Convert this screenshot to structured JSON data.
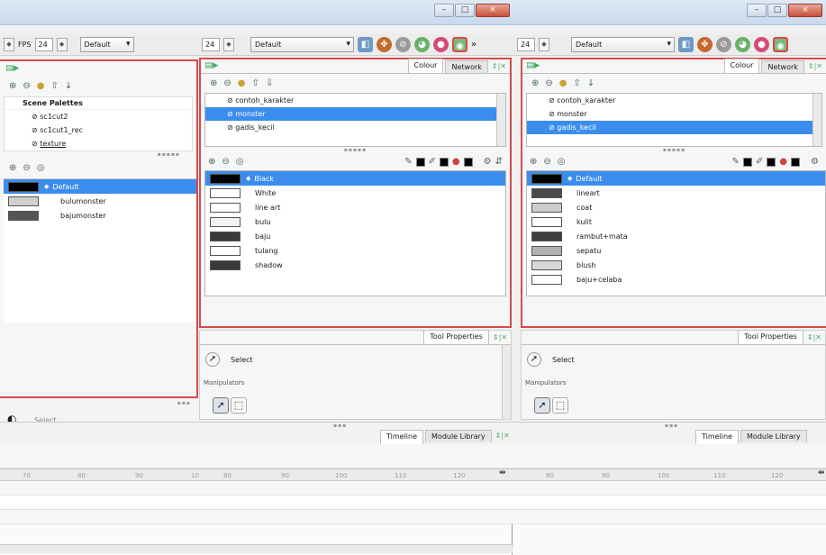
{
  "colors": {
    "selection": "#3b8ded",
    "frame": "#d84b4b"
  },
  "toolbar": {
    "fps_label": "FPS",
    "fps_value": "24",
    "left_dropdown": "Default",
    "mid_fps": "24",
    "mid_dropdown": "Default",
    "right_fps": "24",
    "right_dropdown": "Default",
    "overflow": "»"
  },
  "window_buttons": {
    "minimize": "–",
    "maximize": "□",
    "close": "×"
  },
  "left": {
    "panel_title": "Scene Palettes",
    "scene_palettes": [
      "sc1cut2",
      "sc1cut1_rec",
      "texture"
    ],
    "colours": [
      {
        "name": "Default",
        "hex": "#000000",
        "selected": true
      },
      {
        "name": "bulumonster",
        "hex": "#cfcfcf"
      },
      {
        "name": "bajumonster",
        "hex": "#555555"
      }
    ],
    "tool_label": "Select",
    "ruler": [
      "70",
      "80",
      "90",
      "10"
    ]
  },
  "mid": {
    "tabs": {
      "colour": "Colour",
      "network": "Network"
    },
    "palettes": [
      {
        "name": "contoh_karakter",
        "selected": false
      },
      {
        "name": "monster",
        "selected": true
      },
      {
        "name": "gadis_kecil",
        "selected": false
      }
    ],
    "colours": [
      {
        "name": "Black",
        "hex": "#000000",
        "selected": true
      },
      {
        "name": "White",
        "hex": "#ffffff"
      },
      {
        "name": "line art",
        "hex": "#ffffff"
      },
      {
        "name": "bulu",
        "hex": "#f2f2f2"
      },
      {
        "name": "baju",
        "hex": "#3a3a3a"
      },
      {
        "name": "tulang",
        "hex": "#ffffff"
      },
      {
        "name": "shadow",
        "hex": "#3a3a3a"
      }
    ],
    "tool_tab": "Tool Properties",
    "select_label": "Select",
    "manipulators_label": "Manipulators",
    "timeline_tabs": {
      "timeline": "Timeline",
      "module_library": "Module Library"
    },
    "ruler": [
      "80",
      "90",
      "100",
      "110",
      "120"
    ]
  },
  "right": {
    "tabs": {
      "colour": "Colour",
      "network": "Network"
    },
    "palettes": [
      {
        "name": "contoh_karakter",
        "selected": false
      },
      {
        "name": "monster",
        "selected": false
      },
      {
        "name": "gadis_kecil",
        "selected": true
      }
    ],
    "colours": [
      {
        "name": "Default",
        "hex": "#000000",
        "selected": true
      },
      {
        "name": "lineart",
        "hex": "#4a4a4a"
      },
      {
        "name": "coat",
        "hex": "#cccccc"
      },
      {
        "name": "kulit",
        "hex": "#ffffff"
      },
      {
        "name": "rambut+mata",
        "hex": "#3d3d3d"
      },
      {
        "name": "sepatu",
        "hex": "#b0b0b0"
      },
      {
        "name": "blush",
        "hex": "#d8d8d8"
      },
      {
        "name": "baju+celaba",
        "hex": "#ffffff"
      }
    ],
    "tool_tab": "Tool Properties",
    "select_label": "Select",
    "manipulators_label": "Manipulators",
    "timeline_tabs": {
      "timeline": "Timeline",
      "module_library": "Module Library"
    },
    "ruler": [
      "80",
      "90",
      "100",
      "110",
      "120"
    ]
  },
  "dock_controls": "⇕|✕"
}
